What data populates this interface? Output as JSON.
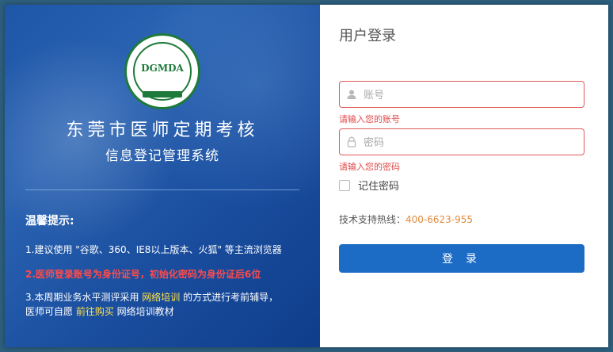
{
  "logo": {
    "abbr": "DGMDA"
  },
  "left": {
    "title": "东莞市医师定期考核",
    "subtitle": "信息登记管理系统",
    "tips_heading": "温馨提示:",
    "tip1": "1.建议使用 \"谷歌、360、IE8以上版本、火狐\" 等主流浏览器",
    "tip2": "2.医师登录账号为身份证号，初始化密码为身份证后6位",
    "tip3_a": "3.本周期业务水平测评采用 ",
    "tip3_hl": "网络培训",
    "tip3_b": " 的方式进行考前辅导，",
    "tip3_c": "医师可自愿 ",
    "tip3_hl2": "前往购买",
    "tip3_d": " 网络培训教材"
  },
  "login": {
    "title": "用户登录",
    "account_placeholder": "账号",
    "account_error": "请输入您的账号",
    "password_placeholder": "密码",
    "password_error": "请输入您的密码",
    "remember_label": "记住密码",
    "support_label": "技术支持热线：",
    "support_number": "400-6623-955",
    "submit_label": "登 录"
  },
  "colors": {
    "accent": "#1c6cc6",
    "error": "#e04848",
    "highlight": "#ffe24a"
  },
  "icons": {
    "account": "user-icon",
    "password": "lock-icon"
  }
}
